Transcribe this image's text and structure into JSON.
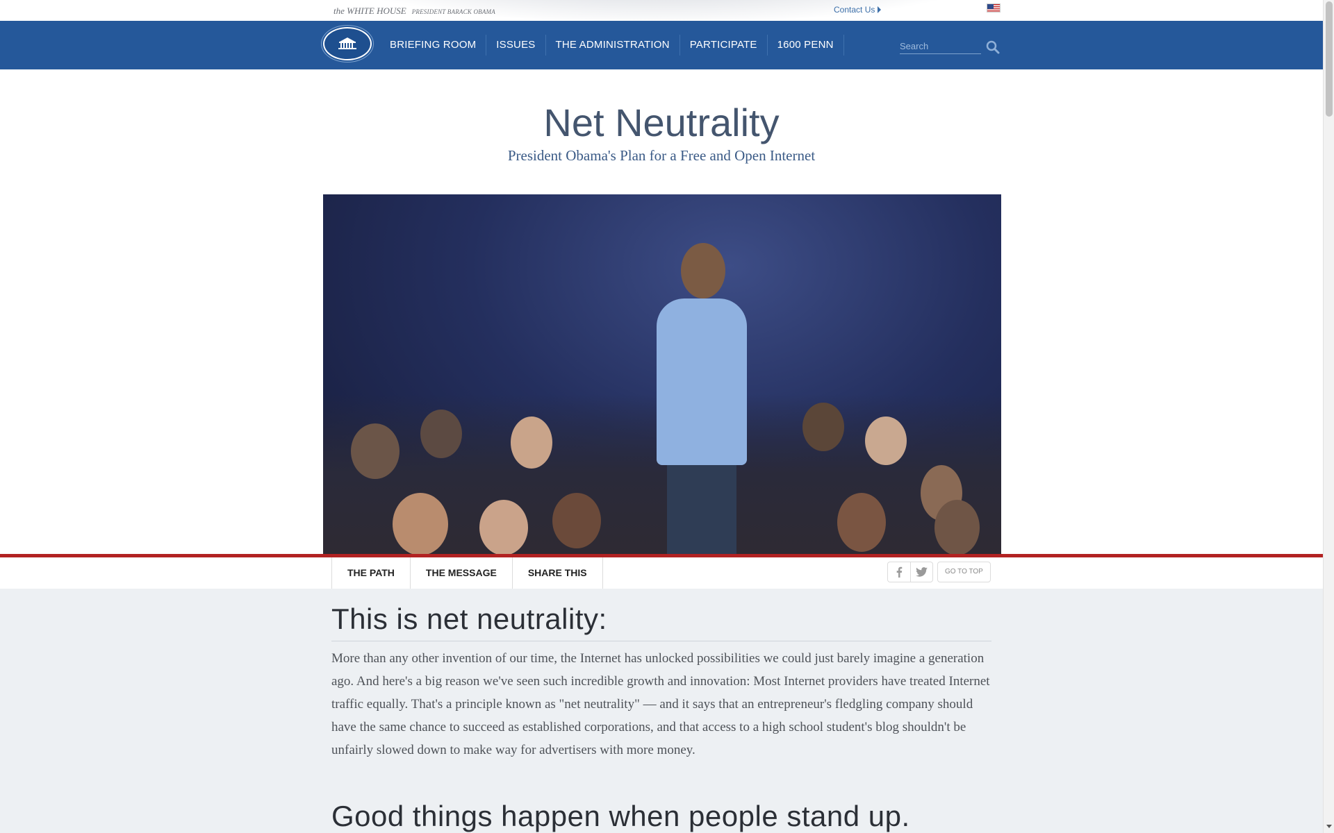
{
  "topbar": {
    "brand": "the WHITE HOUSE",
    "brand_sub": "PRESIDENT BARACK OBAMA",
    "contact_label": "Contact Us",
    "flag_icon": "us-flag-icon"
  },
  "nav": {
    "items": [
      "BRIEFING ROOM",
      "ISSUES",
      "THE ADMINISTRATION",
      "PARTICIPATE",
      "1600 PENN"
    ],
    "search_placeholder": "Search",
    "search_icon": "search-icon",
    "color": "#25589a"
  },
  "hero": {
    "title": "Net Neutrality",
    "subtitle": "President Obama's Plan for a Free and Open Internet",
    "photo": "photo-president-speaking-to-audience"
  },
  "subnav": {
    "tabs": [
      "THE PATH",
      "THE MESSAGE",
      "SHARE THIS"
    ],
    "facebook_icon": "facebook-icon",
    "twitter_icon": "twitter-icon",
    "go_to_top": "GO TO TOP",
    "accent": "#b22222"
  },
  "content": {
    "heading1": "This is net neutrality:",
    "paragraph1": "More than any other invention of our time, the Internet has unlocked possibilities we could just barely imagine a generation ago. And here's a big reason we've seen such incredible growth and innovation: Most Internet providers have treated Internet traffic equally. That's a principle known as \"net neutrality\" — and it says that an entrepreneur's fledgling company should have the same chance to succeed as established corporations, and that access to a high school student's blog shouldn't be unfairly slowed down to make way for advertisers with more money.",
    "heading2": "Good things happen when people stand up."
  }
}
